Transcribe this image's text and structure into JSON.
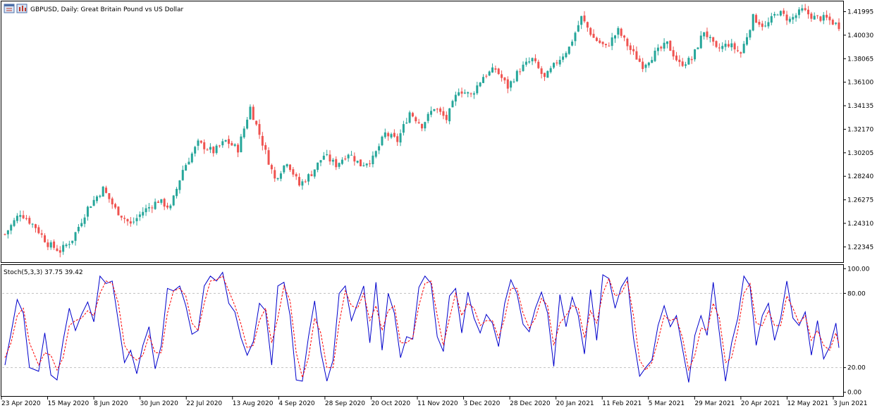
{
  "header": {
    "symbol_title": "GBPUSD, Daily:  Great Britain Pound vs US Dollar",
    "icons": [
      "chart-window-icon",
      "chart-bars-icon"
    ]
  },
  "indicator": {
    "label": "Stoch(5,3,3) 37.75 39.42"
  },
  "colors": {
    "bull": "#26a69a",
    "bear": "#ef5350",
    "main_line": "#0000cc",
    "signal_line": "#ff0000",
    "frame": "#000000",
    "level": "#c0c0c0"
  },
  "chart_data": [
    {
      "type": "candlestick",
      "title": "GBPUSD, Daily:  Great Britain Pound vs US Dollar",
      "y_ticks": [
        "1.41995",
        "1.40030",
        "1.38065",
        "1.36100",
        "1.34135",
        "1.32170",
        "1.30205",
        "1.28240",
        "1.26275",
        "1.24310",
        "1.22345"
      ],
      "y_tick_values": [
        1.41995,
        1.4003,
        1.38065,
        1.361,
        1.34135,
        1.3217,
        1.30205,
        1.2824,
        1.26275,
        1.2431,
        1.22345
      ],
      "ylim": [
        1.2107,
        1.4285
      ],
      "x_ticks": [
        "23 Apr 2020",
        "15 May 2020",
        "8 Jun 2020",
        "30 Jun 2020",
        "22 Jul 2020",
        "13 Aug 2020",
        "4 Sep 2020",
        "28 Sep 2020",
        "20 Oct 2020",
        "11 Nov 2020",
        "3 Dec 2020",
        "28 Dec 2020",
        "20 Jan 2021",
        "11 Feb 2021",
        "5 Mar 2021",
        "29 Mar 2021",
        "20 Apr 2021",
        "12 May 2021",
        "3 Jun 2021"
      ],
      "anchors": [
        [
          0,
          1.234
        ],
        [
          5,
          1.252
        ],
        [
          10,
          1.24
        ],
        [
          14,
          1.226
        ],
        [
          18,
          1.22
        ],
        [
          22,
          1.23
        ],
        [
          27,
          1.256
        ],
        [
          32,
          1.272
        ],
        [
          36,
          1.255
        ],
        [
          41,
          1.242
        ],
        [
          45,
          1.253
        ],
        [
          50,
          1.262
        ],
        [
          54,
          1.256
        ],
        [
          58,
          1.288
        ],
        [
          63,
          1.31
        ],
        [
          68,
          1.303
        ],
        [
          72,
          1.312
        ],
        [
          76,
          1.305
        ],
        [
          80,
          1.34
        ],
        [
          84,
          1.31
        ],
        [
          88,
          1.28
        ],
        [
          92,
          1.295
        ],
        [
          96,
          1.275
        ],
        [
          100,
          1.285
        ],
        [
          104,
          1.3
        ],
        [
          108,
          1.292
        ],
        [
          112,
          1.302
        ],
        [
          116,
          1.292
        ],
        [
          120,
          1.297
        ],
        [
          124,
          1.318
        ],
        [
          128,
          1.312
        ],
        [
          132,
          1.336
        ],
        [
          136,
          1.325
        ],
        [
          140,
          1.34
        ],
        [
          144,
          1.33
        ],
        [
          148,
          1.355
        ],
        [
          152,
          1.35
        ],
        [
          156,
          1.366
        ],
        [
          160,
          1.372
        ],
        [
          164,
          1.357
        ],
        [
          168,
          1.372
        ],
        [
          172,
          1.38
        ],
        [
          176,
          1.364
        ],
        [
          180,
          1.378
        ],
        [
          184,
          1.39
        ],
        [
          188,
          1.415
        ],
        [
          192,
          1.398
        ],
        [
          196,
          1.39
        ],
        [
          200,
          1.404
        ],
        [
          204,
          1.388
        ],
        [
          208,
          1.375
        ],
        [
          212,
          1.385
        ],
        [
          216,
          1.393
        ],
        [
          220,
          1.376
        ],
        [
          224,
          1.38
        ],
        [
          228,
          1.404
        ],
        [
          232,
          1.388
        ],
        [
          236,
          1.393
        ],
        [
          240,
          1.385
        ],
        [
          244,
          1.415
        ],
        [
          248,
          1.407
        ],
        [
          252,
          1.42
        ],
        [
          256,
          1.413
        ],
        [
          260,
          1.421
        ],
        [
          264,
          1.415
        ],
        [
          268,
          1.414
        ],
        [
          272,
          1.408
        ]
      ],
      "bar_count": 273
    },
    {
      "type": "line",
      "title": "Stoch(5,3,3) 37.75 39.42",
      "y_ticks": [
        "100.00",
        "80.00",
        "20.00",
        "0.00"
      ],
      "y_tick_values": [
        100,
        80,
        20,
        0
      ],
      "levels": [
        80,
        20
      ],
      "ylim": [
        -3,
        103
      ],
      "series": [
        {
          "name": "Stoch(5,3,3) main",
          "x": [
            0,
            2,
            4,
            6,
            8,
            11,
            13,
            15,
            17,
            19,
            21,
            23,
            25,
            27,
            29,
            31,
            33,
            35,
            37,
            39,
            41,
            43,
            45,
            47,
            49,
            51,
            53,
            55,
            57,
            59,
            61,
            63,
            65,
            67,
            69,
            71,
            73,
            75,
            77,
            79,
            81,
            83,
            85,
            87,
            89,
            91,
            93,
            95,
            97,
            99,
            101,
            103,
            105,
            107,
            109,
            111,
            113,
            115,
            117,
            119,
            121,
            123,
            125,
            127,
            129,
            131,
            133,
            135,
            137,
            139,
            141,
            143,
            145,
            147,
            149,
            151,
            153,
            155,
            157,
            159,
            161,
            163,
            165,
            167,
            169,
            171,
            173,
            175,
            177,
            179,
            181,
            183,
            185,
            187,
            189,
            191,
            193,
            195,
            197,
            199,
            201,
            203,
            205,
            207,
            209,
            211,
            213,
            215,
            217,
            219,
            221,
            223,
            225,
            227,
            229,
            231,
            233,
            235,
            237,
            239,
            241,
            243,
            245,
            247,
            249,
            251,
            253,
            255,
            257,
            259,
            261,
            263,
            265,
            267,
            269,
            271,
            272
          ],
          "values": [
            22,
            48,
            75,
            64,
            20,
            17,
            48,
            14,
            10,
            42,
            68,
            50,
            63,
            73,
            57,
            94,
            88,
            90,
            57,
            24,
            34,
            15,
            38,
            53,
            19,
            38,
            84,
            82,
            86,
            70,
            47,
            50,
            86,
            94,
            90,
            97,
            72,
            65,
            44,
            30,
            41,
            72,
            66,
            22,
            86,
            89,
            62,
            10,
            9,
            45,
            74,
            33,
            9,
            26,
            80,
            86,
            58,
            72,
            86,
            40,
            89,
            34,
            80,
            64,
            28,
            45,
            43,
            85,
            94,
            88,
            45,
            33,
            78,
            84,
            48,
            81,
            60,
            48,
            63,
            56,
            37,
            72,
            91,
            80,
            55,
            49,
            68,
            81,
            64,
            21,
            79,
            53,
            77,
            62,
            31,
            83,
            42,
            95,
            92,
            68,
            85,
            93,
            44,
            13,
            20,
            26,
            54,
            70,
            53,
            62,
            35,
            8,
            46,
            62,
            46,
            89,
            48,
            9,
            40,
            60,
            94,
            86,
            38,
            62,
            72,
            42,
            60,
            90,
            60,
            54,
            65,
            30,
            58,
            27,
            37,
            56,
            36
          ]
        },
        {
          "name": "Stoch(5,3,3) signal",
          "x": [
            0,
            2,
            4,
            6,
            8,
            11,
            13,
            15,
            17,
            19,
            21,
            23,
            25,
            27,
            29,
            31,
            33,
            35,
            37,
            39,
            41,
            43,
            45,
            47,
            49,
            51,
            53,
            55,
            57,
            59,
            61,
            63,
            65,
            67,
            69,
            71,
            73,
            75,
            77,
            79,
            81,
            83,
            85,
            87,
            89,
            91,
            93,
            95,
            97,
            99,
            101,
            103,
            105,
            107,
            109,
            111,
            113,
            115,
            117,
            119,
            121,
            123,
            125,
            127,
            129,
            131,
            133,
            135,
            137,
            139,
            141,
            143,
            145,
            147,
            149,
            151,
            153,
            155,
            157,
            159,
            161,
            163,
            165,
            167,
            169,
            171,
            173,
            175,
            177,
            179,
            181,
            183,
            185,
            187,
            189,
            191,
            193,
            195,
            197,
            199,
            201,
            203,
            205,
            207,
            209,
            211,
            213,
            215,
            217,
            219,
            221,
            223,
            225,
            227,
            229,
            231,
            233,
            235,
            237,
            239,
            241,
            243,
            245,
            247,
            249,
            251,
            253,
            255,
            257,
            259,
            261,
            263,
            265,
            267,
            269,
            271,
            272
          ],
          "values": [
            28,
            40,
            62,
            68,
            40,
            22,
            32,
            30,
            18,
            28,
            54,
            58,
            60,
            66,
            62,
            80,
            90,
            88,
            72,
            38,
            30,
            26,
            30,
            46,
            32,
            32,
            64,
            82,
            84,
            78,
            56,
            50,
            72,
            90,
            91,
            94,
            82,
            70,
            55,
            36,
            38,
            58,
            68,
            40,
            60,
            86,
            74,
            32,
            12,
            28,
            60,
            48,
            20,
            20,
            56,
            82,
            70,
            68,
            80,
            58,
            70,
            50,
            66,
            70,
            40,
            40,
            44,
            70,
            88,
            90,
            62,
            38,
            60,
            80,
            62,
            72,
            68,
            54,
            58,
            58,
            44,
            60,
            84,
            84,
            64,
            52,
            60,
            76,
            70,
            38,
            56,
            62,
            70,
            68,
            44,
            66,
            56,
            80,
            92,
            78,
            80,
            90,
            62,
            26,
            18,
            24,
            42,
            62,
            58,
            60,
            44,
            18,
            30,
            52,
            50,
            72,
            60,
            24,
            28,
            50,
            80,
            88,
            56,
            54,
            66,
            54,
            54,
            78,
            68,
            56,
            62,
            42,
            50,
            38,
            34,
            48,
            39
          ]
        }
      ]
    }
  ]
}
